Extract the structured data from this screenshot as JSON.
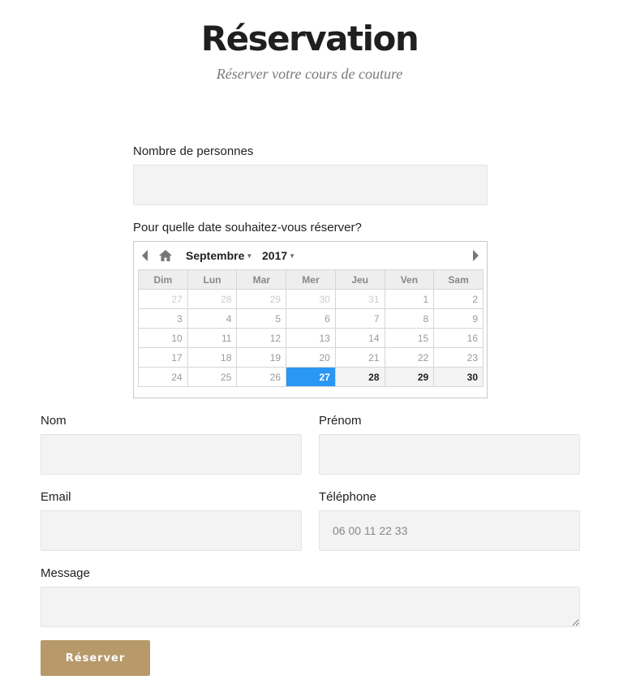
{
  "header": {
    "title": "Réservation",
    "subtitle": "Réserver votre cours de couture"
  },
  "form": {
    "persons": {
      "label": "Nombre de personnes",
      "value": "",
      "placeholder": ""
    },
    "date": {
      "label": "Pour quelle date souhaitez-vous réserver?"
    },
    "nom": {
      "label": "Nom",
      "value": "",
      "placeholder": ""
    },
    "prenom": {
      "label": "Prénom",
      "value": "",
      "placeholder": ""
    },
    "email": {
      "label": "Email",
      "value": "",
      "placeholder": ""
    },
    "telephone": {
      "label": "Téléphone",
      "value": "",
      "placeholder": "06 00 11 22 33"
    },
    "message": {
      "label": "Message",
      "value": "",
      "placeholder": ""
    },
    "submit_label": "Réserver"
  },
  "calendar": {
    "month": "Septembre",
    "year": "2017",
    "weekdays": [
      "Dim",
      "Lun",
      "Mar",
      "Mer",
      "Jeu",
      "Ven",
      "Sam"
    ],
    "weeks": [
      [
        "27",
        "28",
        "29",
        "30",
        "31",
        "1",
        "2"
      ],
      [
        "3",
        "4",
        "5",
        "6",
        "7",
        "8",
        "9"
      ],
      [
        "10",
        "11",
        "12",
        "13",
        "14",
        "15",
        "16"
      ],
      [
        "17",
        "18",
        "19",
        "20",
        "21",
        "22",
        "23"
      ],
      [
        "24",
        "25",
        "26",
        "27",
        "28",
        "29",
        "30"
      ]
    ],
    "selected_day": "27",
    "icons": {
      "prev": "triangle-left-icon",
      "home": "home-icon",
      "next": "triangle-right-icon"
    },
    "colors": {
      "selected": "#2a97f5"
    }
  },
  "colors": {
    "button": "#b8996a",
    "input_background": "#f3f3f3"
  }
}
